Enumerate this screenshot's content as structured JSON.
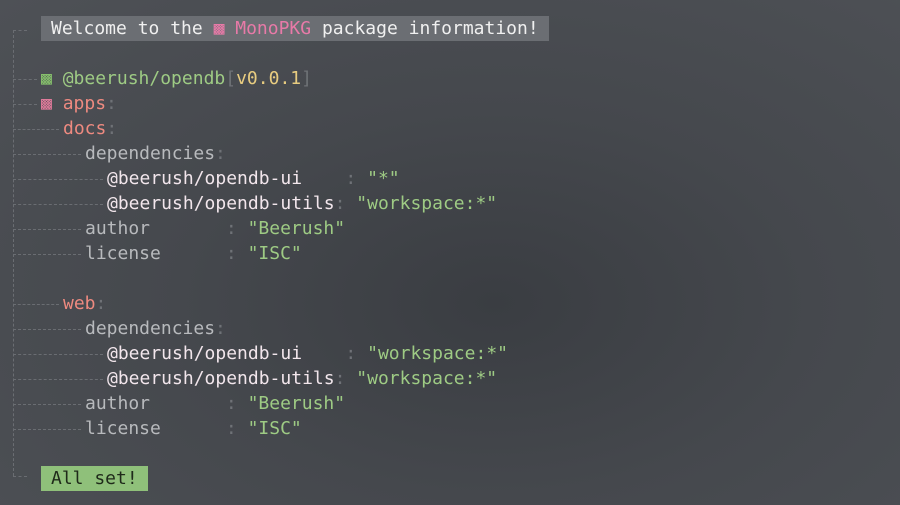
{
  "banner": {
    "prefix": "Welcome to the ",
    "icon": "▩",
    "brand": "MonoPKG",
    "suffix": " package information!"
  },
  "root_package": {
    "icon": "▩",
    "name": "@beerush/opendb",
    "version_open": "[",
    "version": "v0.0.1",
    "version_close": "]"
  },
  "apps": {
    "icon": "▩",
    "label": "apps",
    "colon": ":",
    "items": [
      {
        "name": "docs",
        "deps_label": "dependencies",
        "deps": [
          {
            "pkg": "@beerush/opendb-ui",
            "pad": "   ",
            "value": "\"*\""
          },
          {
            "pkg": "@beerush/opendb-utils",
            "pad": "",
            "value": "\"workspace:*\""
          }
        ],
        "author_label": "author",
        "author": "\"Beerush\"",
        "license_label": "license",
        "license": "\"ISC\""
      },
      {
        "name": "web",
        "deps_label": "dependencies",
        "deps": [
          {
            "pkg": "@beerush/opendb-ui",
            "pad": "   ",
            "value": "\"workspace:*\""
          },
          {
            "pkg": "@beerush/opendb-utils",
            "pad": "",
            "value": "\"workspace:*\""
          }
        ],
        "author_label": "author",
        "author": "\"Beerush\"",
        "license_label": "license",
        "license": "\"ISC\""
      }
    ]
  },
  "footer": {
    "status": "All set!"
  },
  "colors": {
    "brand": "#e87aa8",
    "string": "#9ecb84",
    "version": "#e8cc80",
    "key": "#ee8a80",
    "success_bg": "#8fc07a",
    "banner_bg": "#6b6e73"
  }
}
